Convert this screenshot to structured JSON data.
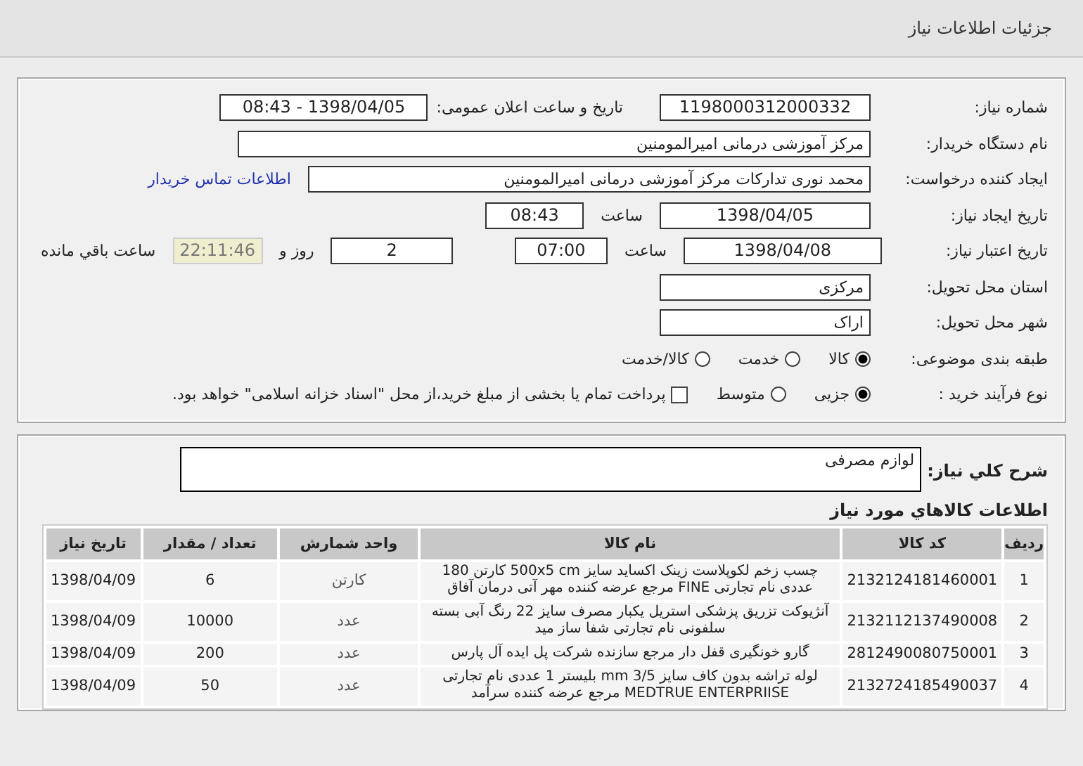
{
  "header": {
    "title": "جزئیات اطلاعات نیاز"
  },
  "details": {
    "need_number": {
      "label": "شماره نیاز:",
      "value": "1198000312000332"
    },
    "announce": {
      "label": "تاریخ و ساعت اعلان عمومی:",
      "value": "1398/04/05 - 08:43"
    },
    "buyer": {
      "label": "نام دستگاه خریدار:",
      "value": "مرکز آموزشی درمانی امیرالمومنین"
    },
    "creator": {
      "label": "ایجاد کننده درخواست:",
      "value": "محمد نوری تدارکات مرکز آموزشی درمانی امیرالمومنین",
      "link": "اطلاعات تماس خریدار"
    },
    "created": {
      "label": "تاریخ ایجاد نیاز:",
      "date": "1398/04/05",
      "time_label": "ساعت",
      "time": "08:43"
    },
    "valid": {
      "label": "تاریخ اعتبار نیاز:",
      "date": "1398/04/08",
      "time_label": "ساعت",
      "time": "07:00",
      "days": "2",
      "days_label": "روز و",
      "remaining": "22:11:46",
      "remaining_label": "ساعت باقي مانده"
    },
    "province": {
      "label": "استان محل تحویل:",
      "value": "مرکزی"
    },
    "city": {
      "label": "شهر محل تحویل:",
      "value": "اراک"
    },
    "category": {
      "label": "طبقه بندی موضوعی:",
      "options": [
        {
          "label": "کالا",
          "selected": true
        },
        {
          "label": "خدمت",
          "selected": false
        },
        {
          "label": "کالا/خدمت",
          "selected": false
        }
      ]
    },
    "process": {
      "label": "نوع فرآیند خرید :",
      "options": [
        {
          "label": "جزیی",
          "selected": true
        },
        {
          "label": "متوسط",
          "selected": false
        }
      ],
      "payment": {
        "checked": false,
        "text": "پرداخت تمام یا بخشی از مبلغ خرید،از محل \"اسناد خزانه اسلامی\" خواهد بود."
      }
    }
  },
  "summary": {
    "label": "شرح کلي نياز:",
    "value": "لوازم مصرفی"
  },
  "goods": {
    "title": "اطلاعات کالاهاي مورد نياز",
    "columns": [
      "ردیف",
      "کد کالا",
      "نام کالا",
      "واحد شمارش",
      "تعداد / مقدار",
      "تاریخ نیاز"
    ],
    "rows": [
      {
        "index": "1",
        "code": "2132124181460001",
        "name": "چسب زخم لکوپلاست زینک اکساید سایز 500x5 cm کارتن 180 عددی نام تجارتی FINE مرجع عرضه کننده مهر آتی درمان آفاق",
        "unit": "کارتن",
        "qty": "6",
        "date": "1398/04/09"
      },
      {
        "index": "2",
        "code": "2132112137490008",
        "name": "آنژیوکت تزریق پزشکی استریل یکبار مصرف سایز 22 رنگ آبی بسته سلفونی نام تجارتی شفا ساز مید",
        "unit": "عدد",
        "qty": "10000",
        "date": "1398/04/09"
      },
      {
        "index": "3",
        "code": "2812490080750001",
        "name": "گارو خونگیری قفل دار مرجع سازنده شرکت پل ایده آل پارس",
        "unit": "عدد",
        "qty": "200",
        "date": "1398/04/09"
      },
      {
        "index": "4",
        "code": "2132724185490037",
        "name": "لوله تراشه بدون کاف سایز 3/5 mm بلیستر 1 عددی نام تجارتی MEDTRUE ENTERPRIISE مرجع عرضه کننده سرآمد",
        "unit": "عدد",
        "qty": "50",
        "date": "1398/04/09"
      }
    ]
  }
}
